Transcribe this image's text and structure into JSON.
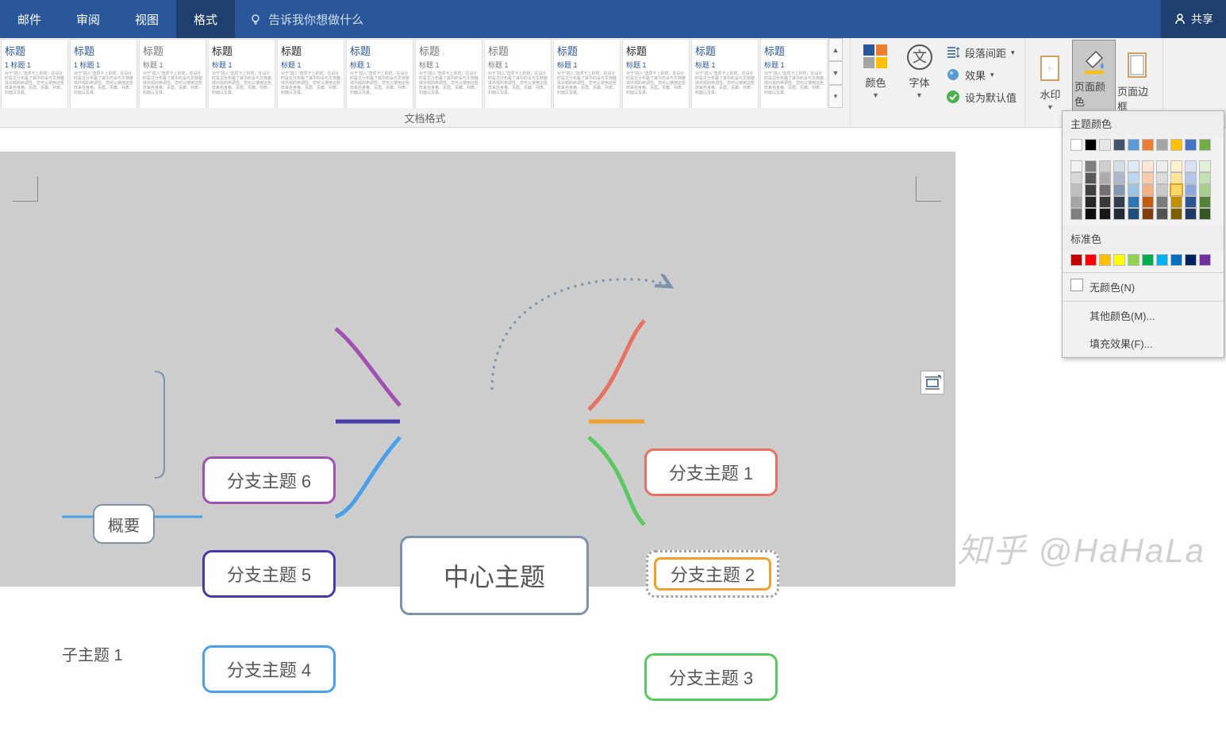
{
  "tabs": {
    "mail": "邮件",
    "review": "审阅",
    "view": "视图",
    "format": "格式"
  },
  "tell_me": "告诉我你想做什么",
  "share": "共享",
  "ribbon": {
    "doc_format_label": "文档格式",
    "style_title": "标题",
    "style_sub": "标题 1",
    "style_sub2": "1 标题 1",
    "colors": "颜色",
    "fonts": "字体",
    "paragraph_spacing": "段落间距",
    "effects": "效果",
    "set_default": "设为默认值",
    "watermark": "水印",
    "page_color": "页面颜色",
    "page_borders": "页面边框"
  },
  "mind": {
    "center": "中心主题",
    "b1": "分支主题 1",
    "b2": "分支主题 2",
    "b3": "分支主题 3",
    "b4": "分支主题 4",
    "b5": "分支主题 5",
    "b6": "分支主题 6",
    "summary": "概要",
    "subtopic": "子主题 1"
  },
  "color_panel": {
    "theme": "主题颜色",
    "standard": "标准色",
    "no_color": "无颜色(N)",
    "more": "其他颜色(M)...",
    "fill": "填充效果(F)...",
    "theme_row1": [
      "#ffffff",
      "#000000",
      "#e7e6e6",
      "#44546a",
      "#5b9bd5",
      "#ed7d31",
      "#a5a5a5",
      "#ffc000",
      "#4472c4",
      "#70ad47"
    ],
    "theme_shades": [
      [
        "#f2f2f2",
        "#7f7f7f",
        "#d0cece",
        "#d6dce4",
        "#deebf6",
        "#fbe5d5",
        "#ededed",
        "#fff2cc",
        "#d9e2f3",
        "#e2efd9"
      ],
      [
        "#d8d8d8",
        "#595959",
        "#aeabab",
        "#adb9ca",
        "#bdd7ee",
        "#f7cbac",
        "#dbdbdb",
        "#fee599",
        "#b4c6e7",
        "#c5e0b3"
      ],
      [
        "#bfbfbf",
        "#3f3f3f",
        "#757070",
        "#8496b0",
        "#9cc3e5",
        "#f4b183",
        "#c9c9c9",
        "#ffd965",
        "#8eaadb",
        "#a8d08d"
      ],
      [
        "#a5a5a5",
        "#262626",
        "#3a3838",
        "#323f4f",
        "#2e75b5",
        "#c55a11",
        "#7b7b7b",
        "#bf9000",
        "#2f5496",
        "#538135"
      ],
      [
        "#7f7f7f",
        "#0c0c0c",
        "#171616",
        "#222a35",
        "#1e4e79",
        "#833c0b",
        "#525252",
        "#7f6000",
        "#1f3864",
        "#375623"
      ]
    ],
    "standard_colors": [
      "#c00000",
      "#ff0000",
      "#ffc000",
      "#ffff00",
      "#92d050",
      "#00b050",
      "#00b0f0",
      "#0070c0",
      "#002060",
      "#7030a0"
    ]
  },
  "lorem": "对于\"插入\"选项卡上的样，在设计时是文分布最了其中的设与文档整体外观的命调性。您可以使用这些样来自身格、页眉、页脚、列表、封面以及其。",
  "watermark_text": "知乎 @HaHaLa"
}
